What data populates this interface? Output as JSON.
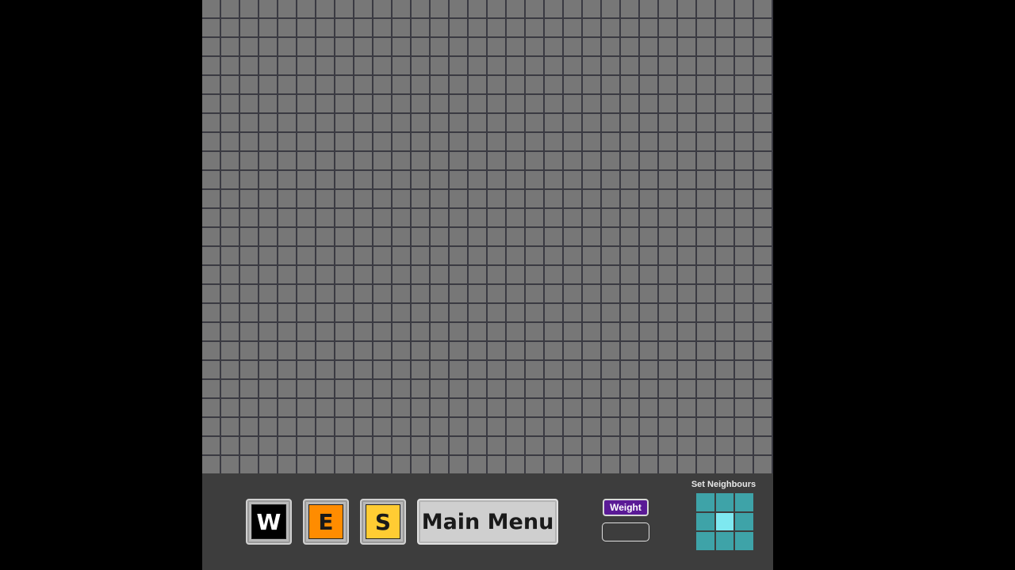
{
  "toolbar": {
    "buttons": [
      {
        "id": "W",
        "label": "W",
        "color": "#000000"
      },
      {
        "id": "E",
        "label": "E",
        "color": "#ff8c00"
      },
      {
        "id": "S",
        "label": "S",
        "color": "#ffcc33"
      }
    ],
    "main_menu_label": "Main Menu",
    "weight": {
      "label": "Weight",
      "value": "",
      "label_color": "#5a1a96"
    },
    "neighbours": {
      "title": "Set Neighbours",
      "cell_color": "#3ea3a8",
      "center_color": "#7ee8f0"
    }
  },
  "grid": {
    "columns": 30,
    "rows": 25,
    "cell_color": "#777777",
    "line_color": "#3a3a42"
  }
}
